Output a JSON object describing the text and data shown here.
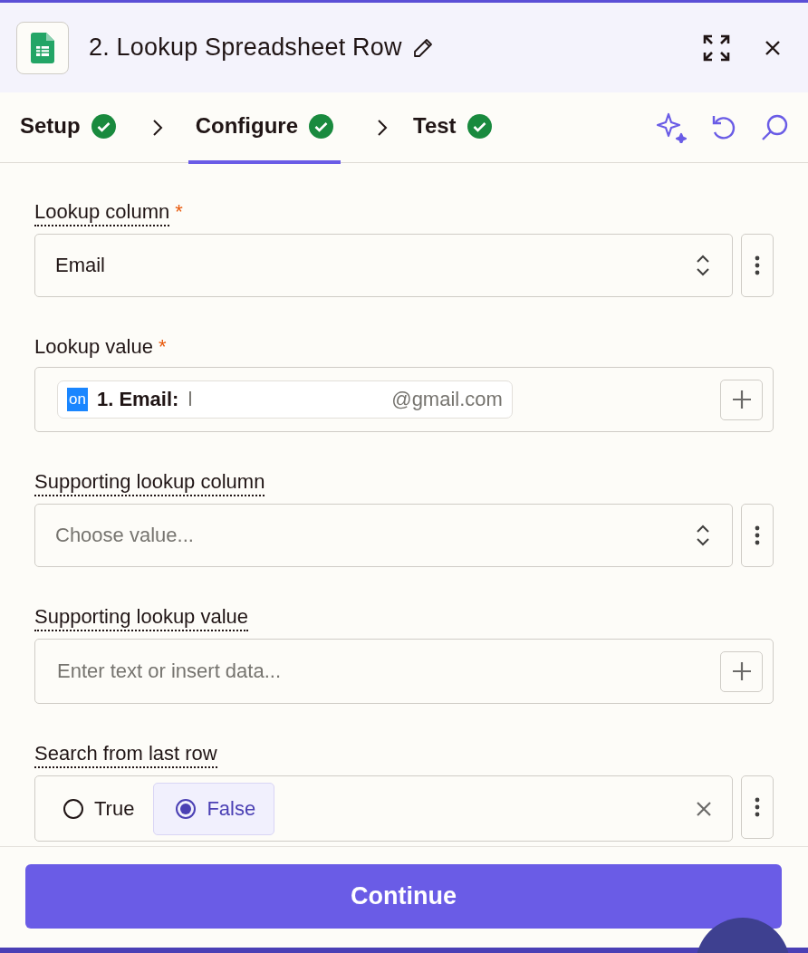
{
  "header": {
    "title": "2. Lookup Spreadsheet Row"
  },
  "steps": [
    {
      "label": "Setup",
      "selected": false,
      "done": true
    },
    {
      "label": "Configure",
      "selected": true,
      "done": true
    },
    {
      "label": "Test",
      "selected": false,
      "done": true
    }
  ],
  "fields": [
    {
      "kind": "select",
      "label": "Lookup column",
      "required_mark": "*",
      "tooltip": true,
      "value": "Email"
    },
    {
      "kind": "mapped",
      "label": "Lookup value",
      "required_mark": "*",
      "tooltip": false,
      "pill": {
        "badge": "on",
        "label": "1. Email:",
        "value_start": "l",
        "value_end": "@gmail.com"
      }
    },
    {
      "kind": "select",
      "label": "Supporting lookup column",
      "tooltip": true,
      "placeholder": "Choose value..."
    },
    {
      "kind": "text",
      "label": "Supporting lookup value",
      "tooltip": true,
      "placeholder": "Enter text or insert data..."
    },
    {
      "kind": "radio",
      "label": "Search from last row",
      "tooltip": true,
      "options": [
        {
          "label": "True",
          "selected": false
        },
        {
          "label": "False",
          "selected": true
        }
      ]
    }
  ],
  "continue_button": "Continue"
}
